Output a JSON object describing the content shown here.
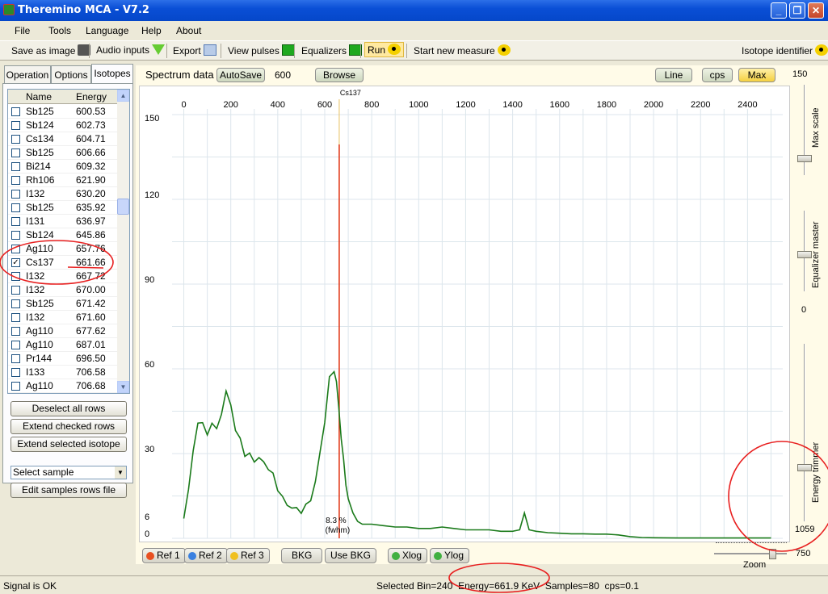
{
  "window": {
    "title": "Theremino MCA - V7.2"
  },
  "menu": [
    "File",
    "Tools",
    "Language",
    "Help",
    "About"
  ],
  "toolbar": {
    "save_image": "Save as image",
    "audio_inputs": "Audio inputs",
    "export": "Export",
    "view_pulses": "View pulses",
    "equalizers": "Equalizers",
    "run": "Run",
    "start_new": "Start new measure",
    "isotope_identifier": "Isotope identifier"
  },
  "left": {
    "tabs": [
      "Operation",
      "Options",
      "Isotopes"
    ],
    "columns": [
      "Name",
      "Energy"
    ],
    "rows": [
      {
        "name": "Sb125",
        "energy": "600.53",
        "checked": false
      },
      {
        "name": "Sb124",
        "energy": "602.73",
        "checked": false
      },
      {
        "name": "Cs134",
        "energy": "604.71",
        "checked": false
      },
      {
        "name": "Sb125",
        "energy": "606.66",
        "checked": false
      },
      {
        "name": "Bi214",
        "energy": "609.32",
        "checked": false
      },
      {
        "name": "Rh106",
        "energy": "621.90",
        "checked": false
      },
      {
        "name": "I132",
        "energy": "630.20",
        "checked": false
      },
      {
        "name": "Sb125",
        "energy": "635.92",
        "checked": false
      },
      {
        "name": "I131",
        "energy": "636.97",
        "checked": false
      },
      {
        "name": "Sb124",
        "energy": "645.86",
        "checked": false
      },
      {
        "name": "Ag110",
        "energy": "657.76",
        "checked": false
      },
      {
        "name": "Cs137",
        "energy": "661.66",
        "checked": true
      },
      {
        "name": "I132",
        "energy": "667.72",
        "checked": false
      },
      {
        "name": "I132",
        "energy": "670.00",
        "checked": false
      },
      {
        "name": "Sb125",
        "energy": "671.42",
        "checked": false
      },
      {
        "name": "I132",
        "energy": "671.60",
        "checked": false
      },
      {
        "name": "Ag110",
        "energy": "677.62",
        "checked": false
      },
      {
        "name": "Ag110",
        "energy": "687.01",
        "checked": false
      },
      {
        "name": "Pr144",
        "energy": "696.50",
        "checked": false
      },
      {
        "name": "I133",
        "energy": "706.58",
        "checked": false
      },
      {
        "name": "Ag110",
        "energy": "706.68",
        "checked": false
      }
    ],
    "buttons": {
      "deselect": "Deselect all rows",
      "extend_checked": "Extend checked rows",
      "extend_selected": "Extend selected isotope",
      "select_sample": "Select sample",
      "edit_samples": "Edit samples rows file"
    }
  },
  "spectrum": {
    "title": "Spectrum data",
    "autosave": "AutoSave",
    "autosave_value": "600",
    "browse": "Browse",
    "line": "Line",
    "cps": "cps",
    "max": "Max",
    "fwhm_percent": "8.3 %",
    "fwhm_label": "(fwhm)",
    "marker_label": "Cs137",
    "bottom_buttons": {
      "ref1": "Ref 1",
      "ref2": "Ref 2",
      "ref3": "Ref 3",
      "bkg": "BKG",
      "use_bkg": "Use BKG",
      "xlog": "Xlog",
      "ylog": "Ylog"
    }
  },
  "right": {
    "max_scale_value": "150",
    "max_scale_label": "Max scale",
    "equalizer_label": "Equalizer master",
    "equalizer_value": "0",
    "energy_trimmer_label": "Energy trimmer",
    "energy_trimmer_value": "1059",
    "zoom_value": "750",
    "zoom_label": "Zoom"
  },
  "status": {
    "signal": "Signal is OK",
    "info": "Selected Bin=240  Energy=661.9 KeV  Samples=80  cps=0.1"
  },
  "chart_data": {
    "type": "line",
    "xlabel": "",
    "ylabel": "",
    "xlim": [
      -50,
      2550
    ],
    "ylim": [
      0,
      150
    ],
    "x_ticks": [
      0,
      200,
      400,
      600,
      800,
      1000,
      1200,
      1400,
      1600,
      1800,
      2000,
      2200,
      2400
    ],
    "y_ticks": [
      0,
      6,
      30,
      60,
      90,
      120,
      150
    ],
    "grid": true,
    "marker": {
      "x": 661.66,
      "label": "Cs137",
      "color": "#E03010"
    },
    "series": [
      {
        "color": "#1A7A1A",
        "x": [
          0,
          20,
          40,
          60,
          80,
          100,
          120,
          140,
          160,
          180,
          200,
          220,
          240,
          260,
          280,
          300,
          320,
          340,
          360,
          380,
          400,
          420,
          440,
          460,
          480,
          500,
          520,
          540,
          560,
          580,
          600,
          620,
          640,
          650,
          660,
          670,
          680,
          690,
          700,
          720,
          740,
          760,
          780,
          800,
          850,
          900,
          950,
          1000,
          1050,
          1100,
          1150,
          1200,
          1250,
          1300,
          1350,
          1400,
          1430,
          1450,
          1470,
          1500,
          1550,
          1600,
          1650,
          1700,
          1750,
          1800,
          1850,
          1900,
          1950,
          2000,
          2100,
          2200,
          2300,
          2400,
          2500
        ],
        "y": [
          7,
          18,
          30,
          42,
          40,
          37,
          41,
          38,
          45,
          51,
          48,
          38,
          35,
          30,
          29,
          28,
          28,
          27,
          25,
          22,
          18,
          14,
          12,
          11,
          10,
          10,
          11,
          14,
          20,
          30,
          42,
          56,
          60,
          55,
          46,
          36,
          27,
          20,
          14,
          9,
          6,
          5,
          5,
          5,
          4.5,
          4,
          4,
          3.5,
          3.5,
          4,
          3.5,
          3,
          3,
          3,
          2.5,
          2.5,
          3,
          9,
          3,
          2.5,
          2,
          1.8,
          1.6,
          1.6,
          1.5,
          1.5,
          1.2,
          0.6,
          0.3,
          0.2,
          0.1,
          0.1,
          0.1,
          0.1,
          0.1
        ]
      }
    ]
  }
}
